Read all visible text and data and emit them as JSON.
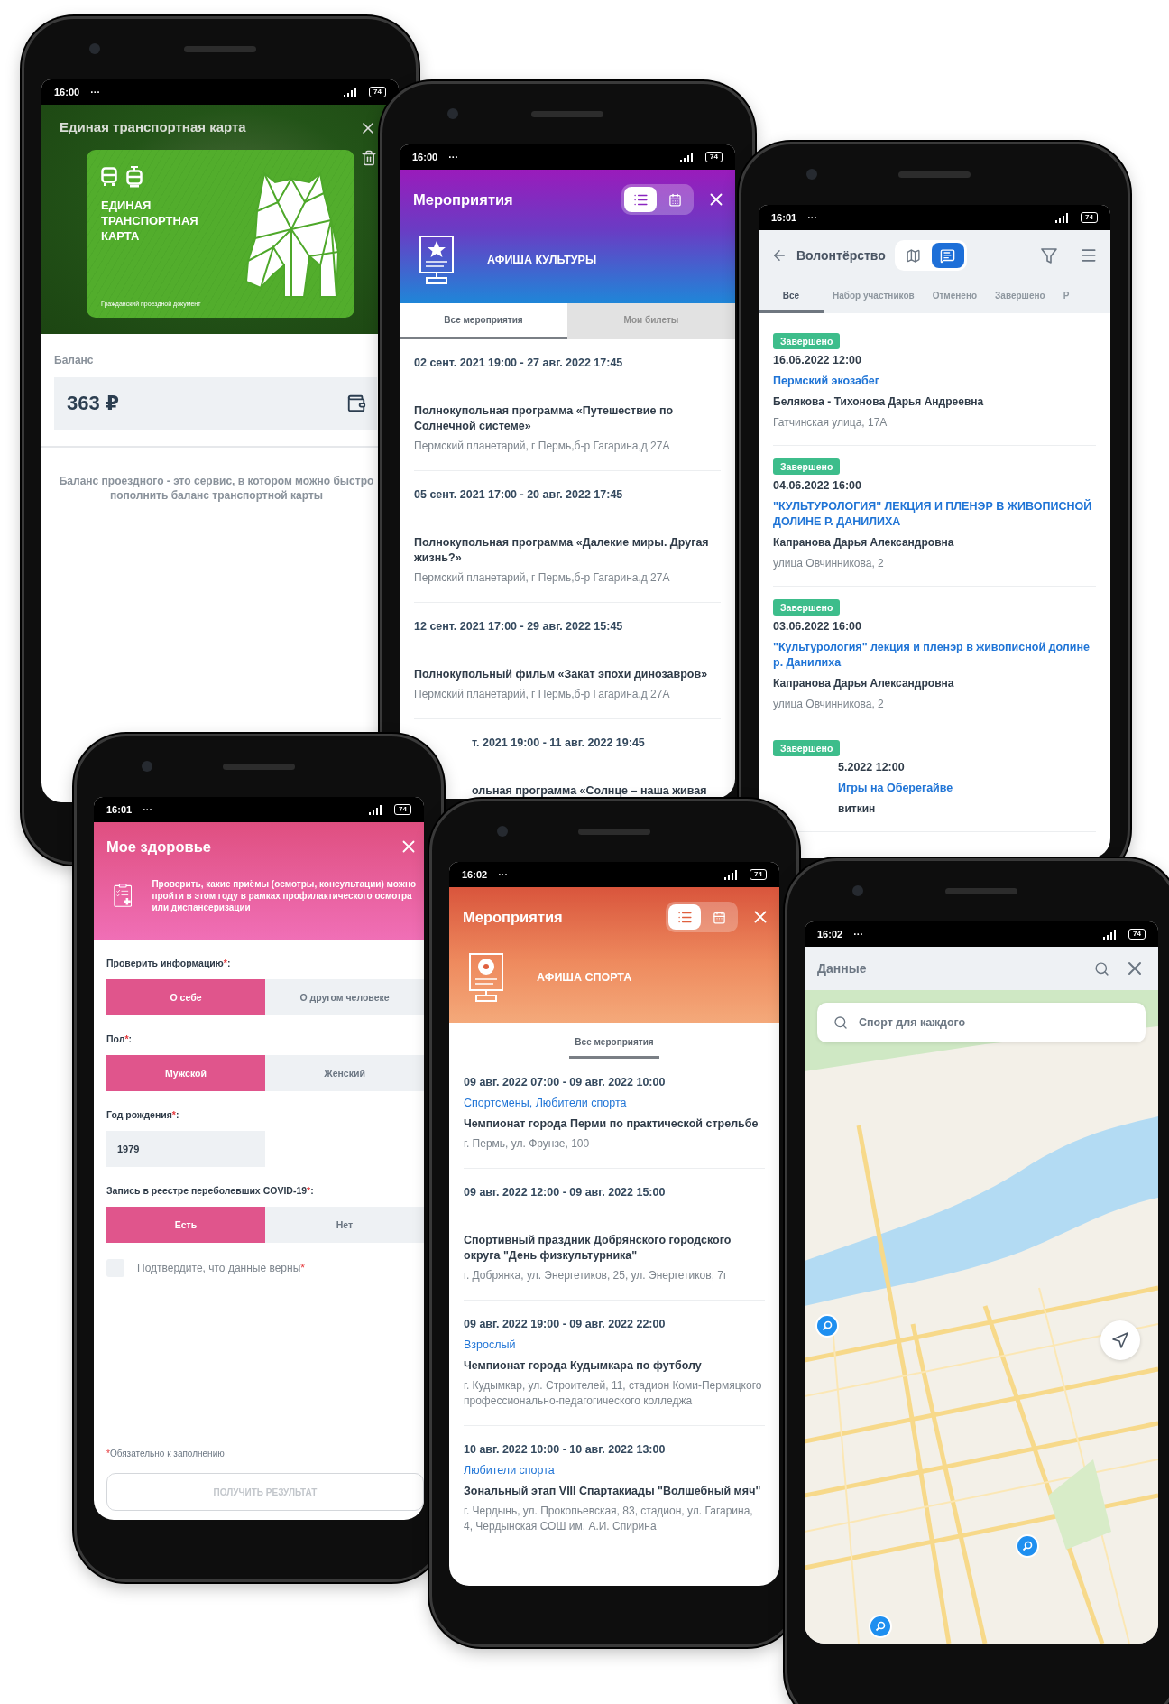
{
  "phones": [
    {
      "kind": "transport",
      "status": {
        "time": "16:00",
        "dots": "···",
        "battery": "74"
      },
      "title": "Единая транспортная карта",
      "card": {
        "name": "ЕДИНАЯ ТРАНСПОРТНАЯ КАРТА",
        "caption": "Гражданский проездной документ"
      },
      "balance_label": "Баланс",
      "balance": "363 ₽",
      "description": "Баланс проездного - это сервис, в котором можно быстро пополнить баланс транспортной карты"
    },
    {
      "kind": "culture",
      "status": {
        "time": "16:00",
        "dots": "···",
        "battery": "74"
      },
      "title": "Мероприятия",
      "views": [
        {
          "kind": "list",
          "selected": true
        },
        {
          "kind": "calendar",
          "selected": false
        }
      ],
      "banner": "АФИША КУЛЬТУРЫ",
      "tabs": [
        {
          "label": "Все мероприятия",
          "selected": true
        },
        {
          "label": "Мои билеты",
          "selected": false
        }
      ],
      "events": [
        {
          "date": "02 сент. 2021 19:00 - 27 авг. 2022 17:45",
          "title": "Полнокупольная программа «Путешествие по Солнечной системе»",
          "place": "Пермский планетарий, г Пермь,б-р Гагарина,д 27А"
        },
        {
          "date": "05 сент. 2021 17:00 - 20 авг. 2022 17:45",
          "title": "Полнокупольная программа «Далекие миры. Другая жизнь?»",
          "place": "Пермский планетарий, г Пермь,б-р Гагарина,д 27А"
        },
        {
          "date": "12 сент. 2021 17:00 - 29 авг. 2022 15:45",
          "title": "Полнокупольный фильм «Закат эпохи динозавров»",
          "place": "Пермский планетарий, г Пермь,б-р Гагарина,д 27А"
        },
        {
          "date": "т. 2021 19:00 - 11 авг. 2022 19:45",
          "title": "ольная программа «Солнце – наша живая"
        }
      ]
    },
    {
      "kind": "volunteer",
      "status": {
        "time": "16:01",
        "dots": "···",
        "battery": "74"
      },
      "title": "Волонтёрство",
      "views": [
        {
          "kind": "map",
          "selected": false
        },
        {
          "kind": "list",
          "selected": true
        }
      ],
      "tabs": [
        {
          "label": "Все",
          "selected": true
        },
        {
          "label": "Набор участников",
          "selected": false
        },
        {
          "label": "Отменено",
          "selected": false
        },
        {
          "label": "Завершено",
          "selected": false
        },
        {
          "label": "Р",
          "selected": false
        }
      ],
      "items": [
        {
          "status": "Завершено",
          "date": "16.06.2022 12:00",
          "title": "Пермский экозабег",
          "person": "Белякова - Тихонова Дарья Андреевна",
          "address": "Гатчинская улица, 17А"
        },
        {
          "status": "Завершено",
          "date": "04.06.2022 16:00",
          "title": "\"КУЛЬТУРОЛОГИЯ\" ЛЕКЦИЯ И ПЛЕНЭР В ЖИВОПИСНОЙ ДОЛИНЕ Р. ДАНИЛИХА",
          "person": "Капранова Дарья Александровна",
          "address": "улица Овчинникова, 2"
        },
        {
          "status": "Завершено",
          "date": "03.06.2022 16:00",
          "title": "\"Культурология\" лекция и пленэр в живописной долине р. Данилиха",
          "person": "Капранова Дарья Александровна",
          "address": "улица Овчинникова, 2"
        },
        {
          "status": "Завершено",
          "date": "5.2022 12:00",
          "title": "Игры на Оберегайве",
          "person": "виткин"
        }
      ]
    },
    {
      "kind": "health",
      "status": {
        "time": "16:01",
        "dots": "···",
        "battery": "74"
      },
      "title": "Мое здоровье",
      "intro": "Проверить, какие приёмы (осмотры, консультации) можно пройти в этом году в рамках профилактического осмотра или диспансеризации",
      "questions": [
        {
          "kind": "choice",
          "label": "Проверить информацию",
          "mark": "*",
          "after": ":",
          "options": [
            {
              "label": "О себе",
              "selected": true
            },
            {
              "label": "О другом человеке",
              "selected": false
            }
          ]
        },
        {
          "kind": "choice",
          "label": "Пол",
          "mark": "*",
          "after": ":",
          "options": [
            {
              "label": "Мужской",
              "selected": true
            },
            {
              "label": "Женский",
              "selected": false
            }
          ]
        },
        {
          "kind": "input",
          "label": "Год рождения",
          "mark": "*",
          "after": ":",
          "value": "1979"
        },
        {
          "kind": "choice",
          "label": "Запись в реестре переболевших COVID-19",
          "mark": "*",
          "after": ":",
          "options": [
            {
              "label": "Есть",
              "selected": true
            },
            {
              "label": "Нет",
              "selected": false
            }
          ]
        }
      ],
      "confirm": {
        "label": "Подтвердите, что данные верны",
        "mark": "*",
        "checked": false
      },
      "note": {
        "mark": "*",
        "text": "Обязательно к заполнению"
      },
      "submit": {
        "label": "ПОЛУЧИТЬ РЕЗУЛЬТАТ",
        "disabled": true
      }
    },
    {
      "kind": "sport",
      "status": {
        "time": "16:02",
        "dots": "···",
        "battery": "74"
      },
      "title": "Мероприятия",
      "views": [
        {
          "kind": "list",
          "selected": true
        },
        {
          "kind": "calendar",
          "selected": false
        }
      ],
      "banner": "АФИША СПОРТА",
      "tabs": [
        {
          "label": "Все мероприятия",
          "selected": true
        }
      ],
      "events": [
        {
          "date": "09 авг. 2022 07:00 - 09 авг. 2022 10:00",
          "category": "Спортсмены, Любители спорта",
          "title": "Чемпионат города Перми по практической стрельбе",
          "place": "г. Пермь, ул. Фрунзе, 100"
        },
        {
          "date": "09 авг. 2022 12:00 - 09 авг. 2022 15:00",
          "title": "Спортивный праздник Добрянского городского округа \"День физкультурника\"",
          "place": "г. Добрянка, ул. Энергетиков, 25, ул. Энергетиков, 7г"
        },
        {
          "date": "09 авг. 2022 19:00 - 09 авг. 2022 22:00",
          "category": "Взрослый",
          "title": "Чемпионат города Кудымкара по футболу",
          "place": "г. Кудымкар, ул. Строителей, 11, стадион Коми-Пермяцкого профессионально-педагогического колледжа"
        },
        {
          "date": "10 авг. 2022 10:00 - 10 авг. 2022 13:00",
          "category": "Любители спорта",
          "title": "Зональный этап VIII Спартакиады \"Волшебный мяч\"",
          "place": "г. Чердынь, ул. Прокопьевская, 83, стадион, ул. Гагарина, 4, Чердынская СОШ им. А.И. Спирина"
        }
      ]
    },
    {
      "kind": "map",
      "status": {
        "time": "16:02",
        "dots": "···",
        "battery": "74"
      },
      "title": "Данные",
      "search": {
        "value": "Спорт для каждого"
      }
    }
  ]
}
